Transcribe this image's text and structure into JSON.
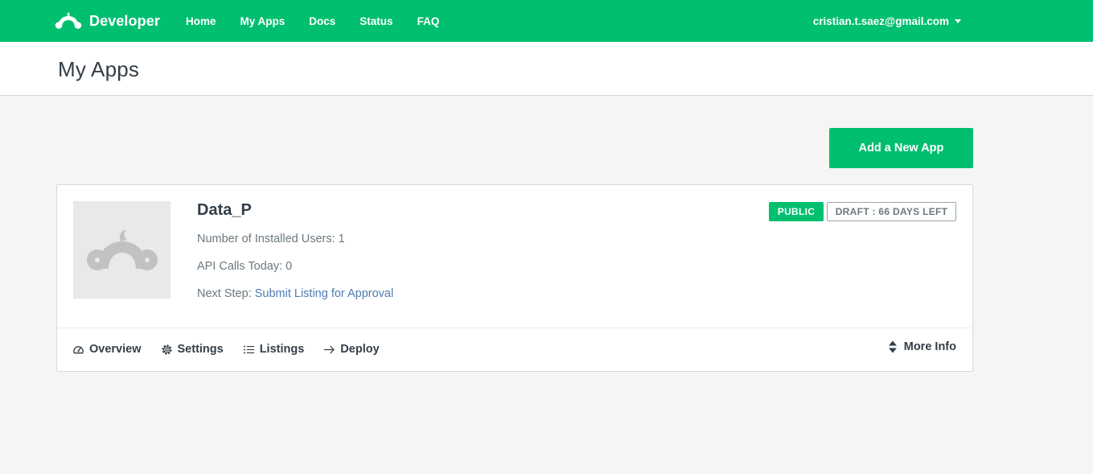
{
  "nav": {
    "brand": "Developer",
    "links": [
      "Home",
      "My Apps",
      "Docs",
      "Status",
      "FAQ"
    ],
    "account_email": "cristian.t.saez@gmail.com"
  },
  "page": {
    "title": "My Apps"
  },
  "toolbar": {
    "add_app_label": "Add a New App"
  },
  "app": {
    "name": "Data_P",
    "installed_users_label": "Number of Installed Users: 1",
    "api_calls_label": "API Calls Today: 0",
    "next_step_prefix": "Next Step:",
    "next_step_link": "Submit Listing for Approval",
    "badge_public": "PUBLIC",
    "badge_draft": "DRAFT : 66 DAYS LEFT",
    "actions": {
      "overview": "Overview",
      "settings": "Settings",
      "listings": "Listings",
      "deploy": "Deploy"
    },
    "more_info": "More Info"
  },
  "colors": {
    "brand_green": "#00bf6f",
    "link_blue": "#507cb6",
    "text_dark": "#333e48",
    "text_muted": "#6b787f"
  },
  "icons": {
    "brand": "surveymonkey-logo-icon",
    "placeholder": "monkey-placeholder-icon",
    "overview": "dashboard-gauge-icon",
    "settings": "gear-icon",
    "listings": "list-icon",
    "deploy": "arrow-right-icon",
    "more_info": "sort-updown-icon",
    "account": "caret-down-icon"
  }
}
